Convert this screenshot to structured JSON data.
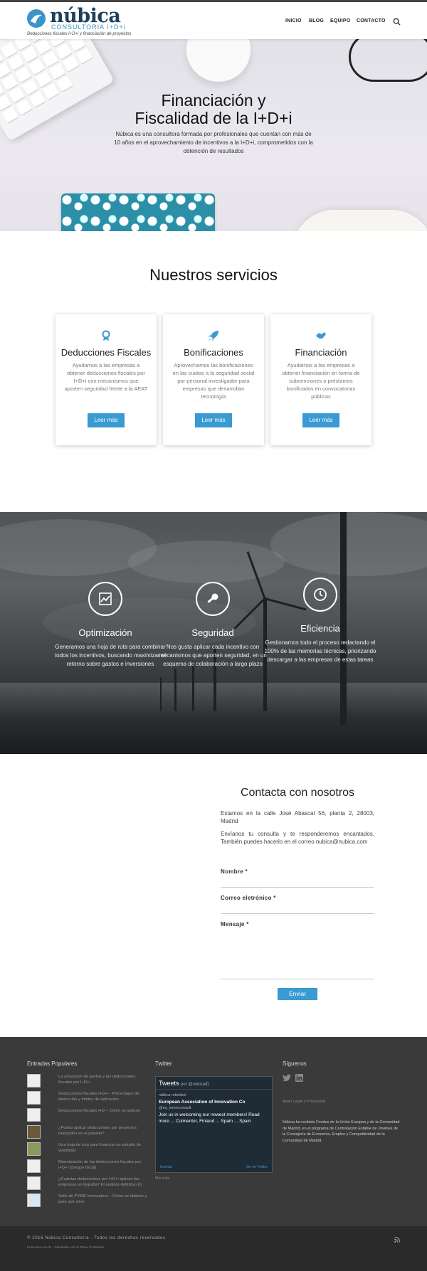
{
  "header": {
    "brand": "núbica",
    "brand_sub": "CONSULTORIA I+D+i",
    "tagline": "Deducciones fiscales I+D+i y financiación de proyectos",
    "nav": [
      "INICIO",
      "BLOG",
      "EQUIPO",
      "CONTACTO"
    ],
    "accent_color": "#3a95c9"
  },
  "hero": {
    "title_line1": "Financiación y",
    "title_line2": "Fiscalidad de la I+D+i",
    "text": "Núbica es una consultora formada por profesionales que cuentan con más de 10 años en el aprovechamiento de incentivos a la I+D+i, comprometidos con la obtención de resultados"
  },
  "services": {
    "title": "Nuestros servicios",
    "cards": [
      {
        "icon": "award-icon",
        "title": "Deducciones Fiscales",
        "text": "Ayudamos a las empresas a obtener deducciones fiscales por I+D+i con mecanismos que aporten seguridad frente a la AEAT",
        "button": "Leer más"
      },
      {
        "icon": "rocket-icon",
        "title": "Bonificaciones",
        "text": "Aprovechamos las bonificaciones en las cuotas a la seguridad social por personal investigador para empresas que desarrollan tecnología",
        "button": "Leer más"
      },
      {
        "icon": "handshake-icon",
        "title": "Financiación",
        "text": "Ayudamos a las empresas a obtener financiación en forma de subvenciones o préstamos bonificados en convocatorias públicas",
        "button": "Leer más"
      }
    ]
  },
  "features": [
    {
      "icon": "chart-icon",
      "title": "Optimización",
      "text": "Generamos una hoja de ruta para combinar todos los incentivos, buscando maximizar el retorno sobre gastos e inversiones"
    },
    {
      "icon": "key-icon",
      "title": "Seguridad",
      "text": "Nos gusta aplicar cada incentivo con mecanismos que aporten seguridad, en un esquema de colaboración a largo plazo"
    },
    {
      "icon": "clock-icon",
      "title": "Eficiencia",
      "text": "Gestionamos todo el proceso redactando el 100% de las memorias técnicas, priorizando descargar a las empresas de estas tareas"
    }
  ],
  "contact": {
    "title": "Contacta con nosotros",
    "address": "Estamos en la calle José Abascal 56, planta 2, 28003, Madrid",
    "invite": "Envíanos tu consulta y te responderemos encantados. También puedes hacerlo en el correo nubica@nubica.com",
    "name_label": "Nombre *",
    "email_label": "Correo eletrónico *",
    "message_label": "Mensaje *",
    "submit": "Enviar"
  },
  "footer": {
    "popular_title": "Entradas Populares",
    "popular": [
      "La activación de gastos y las deducciones fiscales por I+D+i",
      "Deducciones fiscales I+D+i - Porcentajes de deducción y límites de aplicación",
      "Deducciones fiscales I+D – Cómo se aplican",
      "¿Puedo aplicar deducciones por proyectos realizados en el pasado?",
      "Una hoja de ruta para financiar un estudio de viabilidad",
      "Monetización de las deducciones fiscales por I+D+i (cheque fiscal)",
      "¿Cuántas deducciones por I+D+i aplican las empresas en España? El análisis definitivo (I)",
      "Sello de PYME Innovadora – Cómo se obtiene y para qué sirve"
    ],
    "twitter_title": "Twitter",
    "twitter": {
      "header": "Tweets",
      "by": "por @nubicaID",
      "retweet": "núbica retwitteó",
      "account": "European Association of Innovation Co",
      "handle": "@eu_innoxconsult",
      "tweet": "Join us in welcoming our newest members! Read more ... Culmentor, Finland ... Spain ... Spain",
      "embed": "Insertar",
      "view": "Ver en Twitter",
      "tweets_link": "Mis tuits"
    },
    "follow_title": "Síguenos",
    "legal": "Aviso Legal y Privacidad",
    "funding": "Núbica ha recibido Fondos de la Unión Europea y de la Comunidad de Madrid, en el programa de Contratación Estable de Jóvenes de la Consejería de Economía, Empleo y Competitividad de la Comunidad de Madrid.",
    "copyright": "© 2016 Núbica Consultoría - Todos los derechos reservados",
    "powered": "Funciona con ♥ – Diseñado con el Tema Customizr"
  }
}
